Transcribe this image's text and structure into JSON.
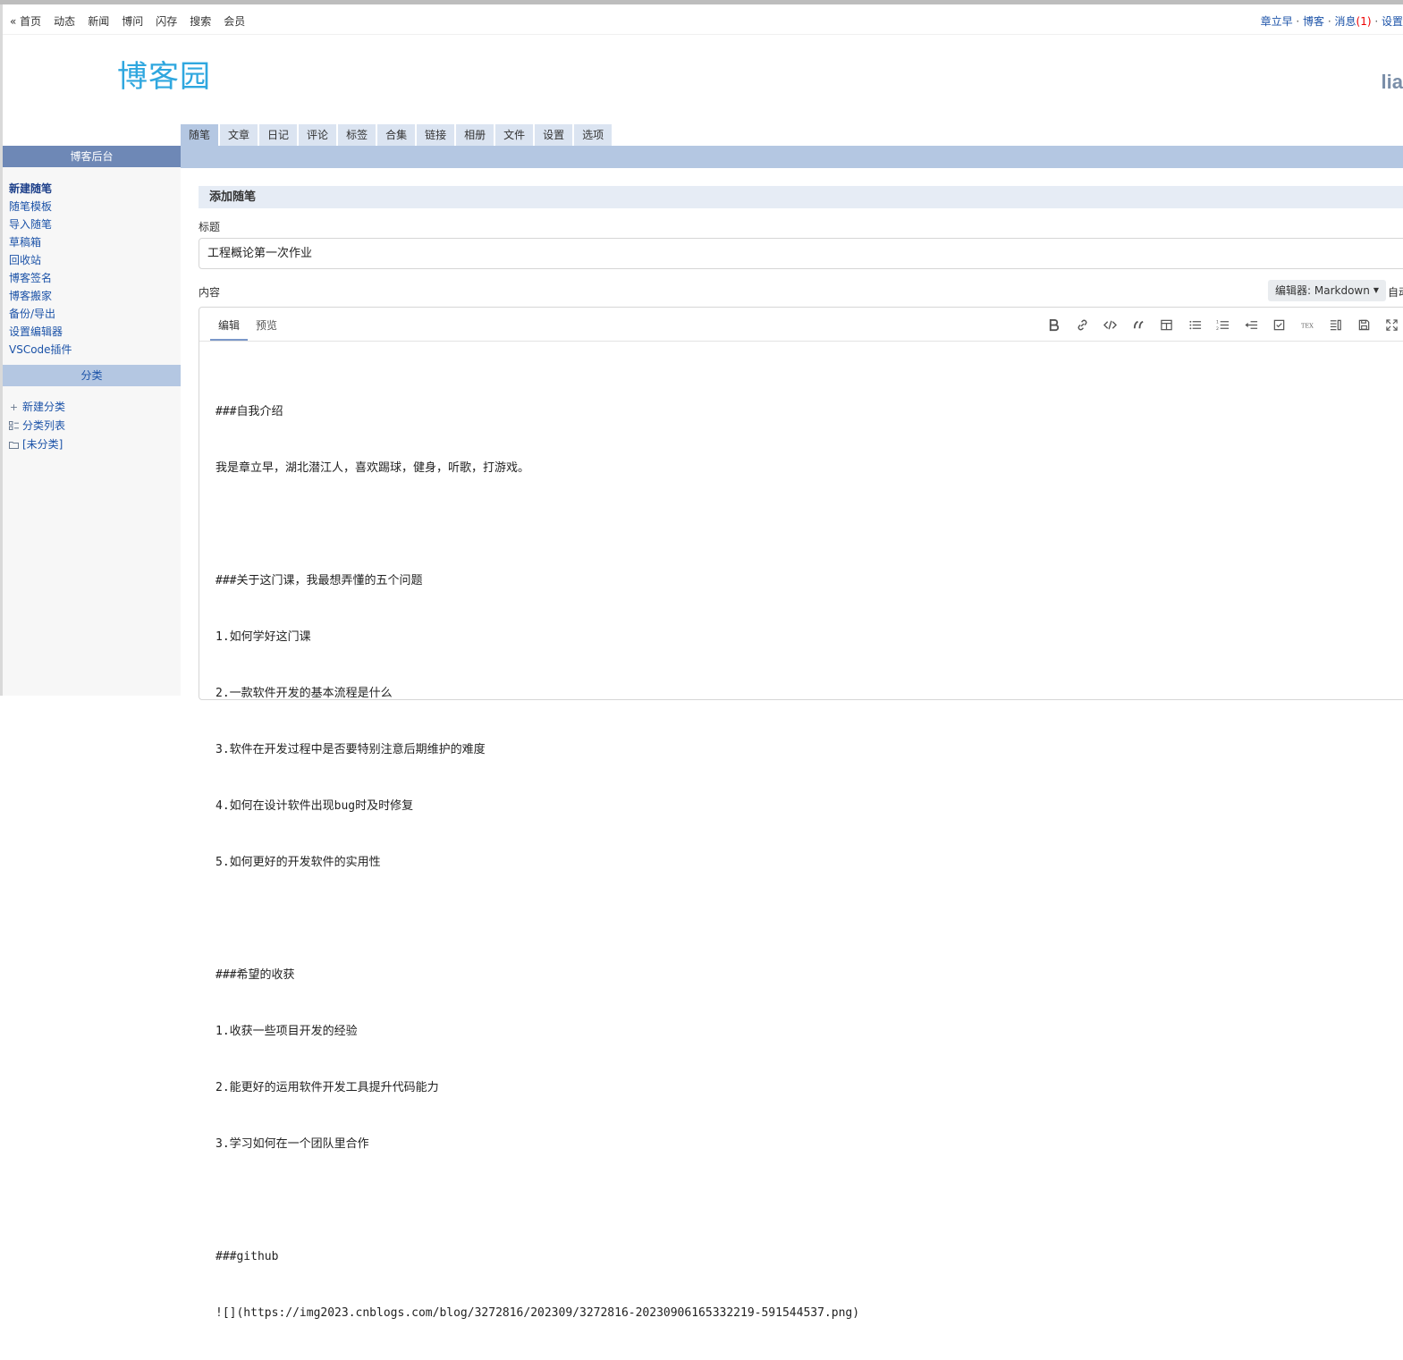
{
  "topnav": {
    "left": [
      "« 首页",
      "动态",
      "新闻",
      "博问",
      "闪存",
      "搜索",
      "会员"
    ],
    "right": {
      "user": "章立早",
      "blog": "博客",
      "messages": "消息",
      "message_count": "(1)",
      "settings": "设置",
      "sep": " · "
    }
  },
  "logo": {
    "text": "博客园"
  },
  "user_fragment": "lia",
  "tabs": [
    "随笔",
    "文章",
    "日记",
    "评论",
    "标签",
    "合集",
    "链接",
    "相册",
    "文件",
    "设置",
    "选项"
  ],
  "sidebar": {
    "header": "博客后台",
    "items": [
      "新建随笔",
      "随笔模板",
      "导入随笔",
      "草稿箱",
      "回收站",
      "博客签名",
      "博客搬家",
      "备份/导出",
      "设置编辑器",
      "VSCode插件"
    ],
    "category_header": "分类",
    "categories": [
      "新建分类",
      "分类列表",
      "[未分类]"
    ]
  },
  "form": {
    "section_title": "添加随笔",
    "title_label": "标题",
    "title_value": "工程概论第一次作业",
    "content_label": "内容",
    "editor_select": "编辑器: Markdown",
    "auto_label": "自动"
  },
  "editor": {
    "tabs": [
      "编辑",
      "预览"
    ],
    "tool_icons": [
      "bold-icon",
      "link-icon",
      "code-icon",
      "quote-icon",
      "table-icon",
      "bullet-list-icon",
      "numbered-list-icon",
      "indent-icon",
      "checkbox-icon",
      "tex-icon",
      "split-view-icon",
      "save-icon",
      "fullscreen-icon"
    ],
    "lines": [
      "###自我介绍",
      "我是章立早，湖北潜江人，喜欢踢球，健身，听歌，打游戏。",
      "",
      "###关于这门课，我最想弄懂的五个问题",
      "1.如何学好这门课",
      "2.一款软件开发的基本流程是什么",
      "3.软件在开发过程中是否要特别注意后期维护的难度",
      "4.如何在设计软件出现bug时及时修复",
      "5.如何更好的开发软件的实用性",
      "",
      "###希望的收获",
      "1.收获一些项目开发的经验",
      "2.能更好的运用软件开发工具提升代码能力",
      "3.学习如何在一个团队里合作",
      "",
      "###github",
      "![](https://img2023.cnblogs.com/blog/3272816/202309/3272816-20230906165332219-591544537.png)"
    ]
  },
  "colors": {
    "accent_blue": "#1c53a8",
    "sidebar_header": "#6e88b6",
    "tab_bar": "#b4c7e2",
    "logo": "#2fa7df"
  }
}
